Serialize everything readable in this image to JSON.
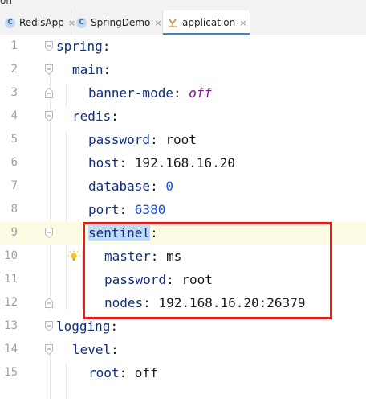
{
  "window": {
    "title_fragment": "on"
  },
  "tabs": [
    {
      "label": "RedisApp",
      "icon": "class-icon",
      "icon_letter": "C",
      "active": false
    },
    {
      "label": "SpringDemo",
      "icon": "class-icon",
      "icon_letter": "C",
      "active": false
    },
    {
      "label": "application",
      "icon": "yaml-icon",
      "active": true
    }
  ],
  "close_glyph": "×",
  "editor": {
    "lines": [
      {
        "num": "1",
        "key": "spring",
        "colon": ":",
        "value": ""
      },
      {
        "num": "2",
        "key": "main",
        "colon": ":",
        "value": ""
      },
      {
        "num": "3",
        "key": "banner-mode",
        "colon": ": ",
        "value": "off"
      },
      {
        "num": "4",
        "key": "redis",
        "colon": ":",
        "value": ""
      },
      {
        "num": "5",
        "key": "password",
        "colon": ": ",
        "value": "root"
      },
      {
        "num": "6",
        "key": "host",
        "colon": ": ",
        "value": "192.168.16.20"
      },
      {
        "num": "7",
        "key": "database",
        "colon": ": ",
        "value": "0"
      },
      {
        "num": "8",
        "key": "port",
        "colon": ": ",
        "value": "6380"
      },
      {
        "num": "9",
        "key": "sentinel",
        "colon": ":",
        "value": ""
      },
      {
        "num": "10",
        "key": "master",
        "colon": ": ",
        "value": "ms"
      },
      {
        "num": "11",
        "key": "password",
        "colon": ": ",
        "value": "root"
      },
      {
        "num": "12",
        "key": "nodes",
        "colon": ": ",
        "value": "192.168.16.20:26379"
      },
      {
        "num": "13",
        "key": "logging",
        "colon": ":",
        "value": ""
      },
      {
        "num": "14",
        "key": "level",
        "colon": ":",
        "value": ""
      },
      {
        "num": "15",
        "key": "root",
        "colon": ": ",
        "value": "off"
      }
    ]
  },
  "colors": {
    "key": "#102f7e",
    "keyword_value": "#871094",
    "number_value": "#1750eb",
    "highlight_box": "#e21b1b",
    "selection": "#bedcf3"
  }
}
